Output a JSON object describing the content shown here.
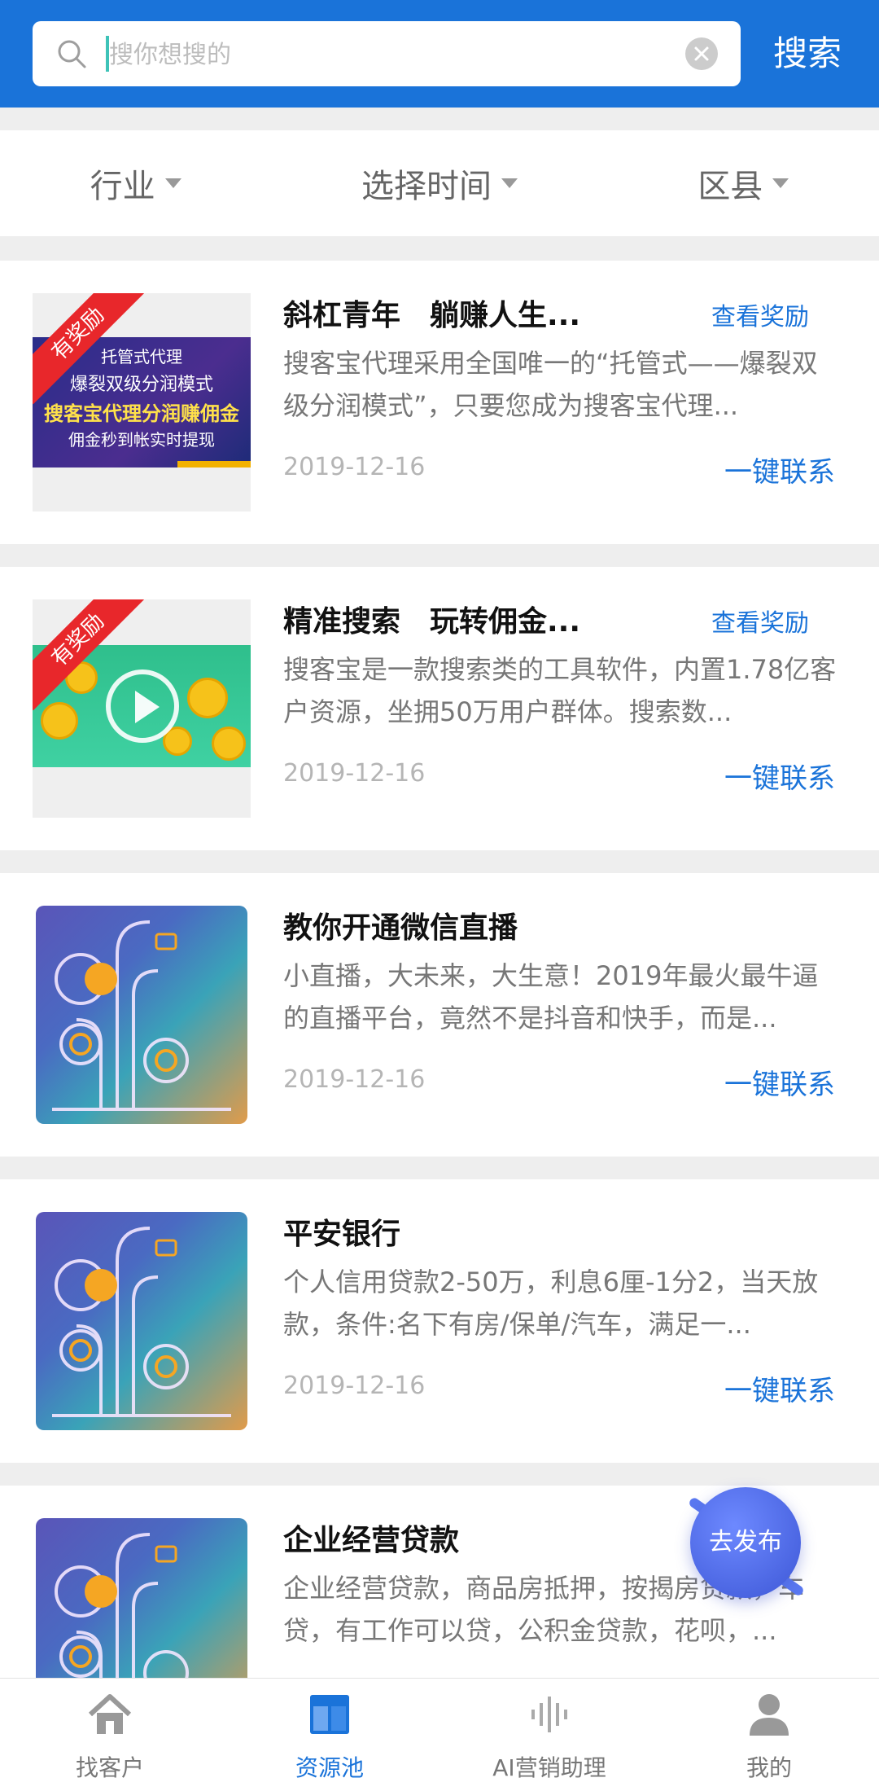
{
  "search": {
    "placeholder": "搜你想搜的",
    "button_label": "搜索"
  },
  "filters": [
    {
      "label": "行业"
    },
    {
      "label": "选择时间"
    },
    {
      "label": "区县"
    }
  ],
  "items": [
    {
      "title": "斜杠青年　躺赚人生...",
      "reward_label": "查看奖励",
      "ribbon": "有奖励",
      "banner": {
        "line1": "托管式代理",
        "line2": "爆裂双级分润模式",
        "line3": "搜客宝代理分润赚佣金",
        "line4": "佣金秒到帐实时提现"
      },
      "desc": "搜客宝代理采用全国唯一的“托管式——爆裂双级分润模式”，只要您成为搜客宝代理...",
      "date": "2019-12-16",
      "contact_label": "一键联系"
    },
    {
      "title": "精准搜索　玩转佣金...",
      "reward_label": "查看奖励",
      "ribbon": "有奖励",
      "desc": "搜客宝是一款搜索类的工具软件，内置1.78亿客户资源，坐拥50万用户群体。搜索数...",
      "date": "2019-12-16",
      "contact_label": "一键联系"
    },
    {
      "title": "教你开通微信直播",
      "desc": "小直播，大未来，大生意！2019年最火最牛逼的直播平台，竟然不是抖音和快手，而是...",
      "date": "2019-12-16",
      "contact_label": "一键联系"
    },
    {
      "title": "平安银行",
      "desc": "个人信用贷款2-50万，利息6厘-1分2，当天放款，条件:名下有房/保单/汽车，满足一...",
      "date": "2019-12-16",
      "contact_label": "一键联系"
    },
    {
      "title": "企业经营贷款",
      "desc": "企业经营贷款，商品房抵押，按揭房贷款，车贷，有工作可以贷，公积金贷款，花呗，...",
      "date": "",
      "contact_label": ""
    }
  ],
  "fab": {
    "label": "去发布"
  },
  "nav": [
    {
      "label": "找客户",
      "icon": "home-icon"
    },
    {
      "label": "资源池",
      "icon": "pool-icon",
      "active": true
    },
    {
      "label": "AI营销助理",
      "icon": "voice-wave-icon"
    },
    {
      "label": "我的",
      "icon": "user-icon"
    }
  ],
  "colors": {
    "primary": "#1a73d9",
    "ribbon": "#e8272b"
  }
}
